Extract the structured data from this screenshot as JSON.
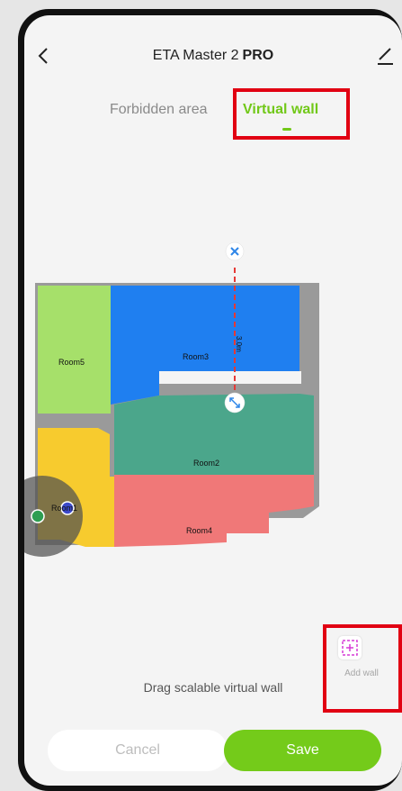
{
  "header": {
    "title": "ETA Master 2",
    "title_suffix": "PRO",
    "back_icon": "chevron-left-icon",
    "edit_icon": "pencil-icon"
  },
  "tabs": [
    {
      "label": "Forbidden area",
      "active": false
    },
    {
      "label": "Virtual wall",
      "active": true
    }
  ],
  "map": {
    "rooms": [
      {
        "name": "Room5",
        "color": "#a6e06a"
      },
      {
        "name": "Room3",
        "color": "#1f7ff0"
      },
      {
        "name": "Room2",
        "color": "#4ba68b"
      },
      {
        "name": "Room4",
        "color": "#f07878"
      },
      {
        "name": "Room1",
        "color": "#f7cb2e"
      }
    ],
    "wall_length": "3.0m"
  },
  "add_wall_label": "Add wall",
  "hint": "Drag scalable virtual wall",
  "buttons": {
    "cancel": "Cancel",
    "save": "Save"
  },
  "colors": {
    "accent": "#74cb1a",
    "highlight": "#e10012",
    "wall": "#e53935"
  }
}
